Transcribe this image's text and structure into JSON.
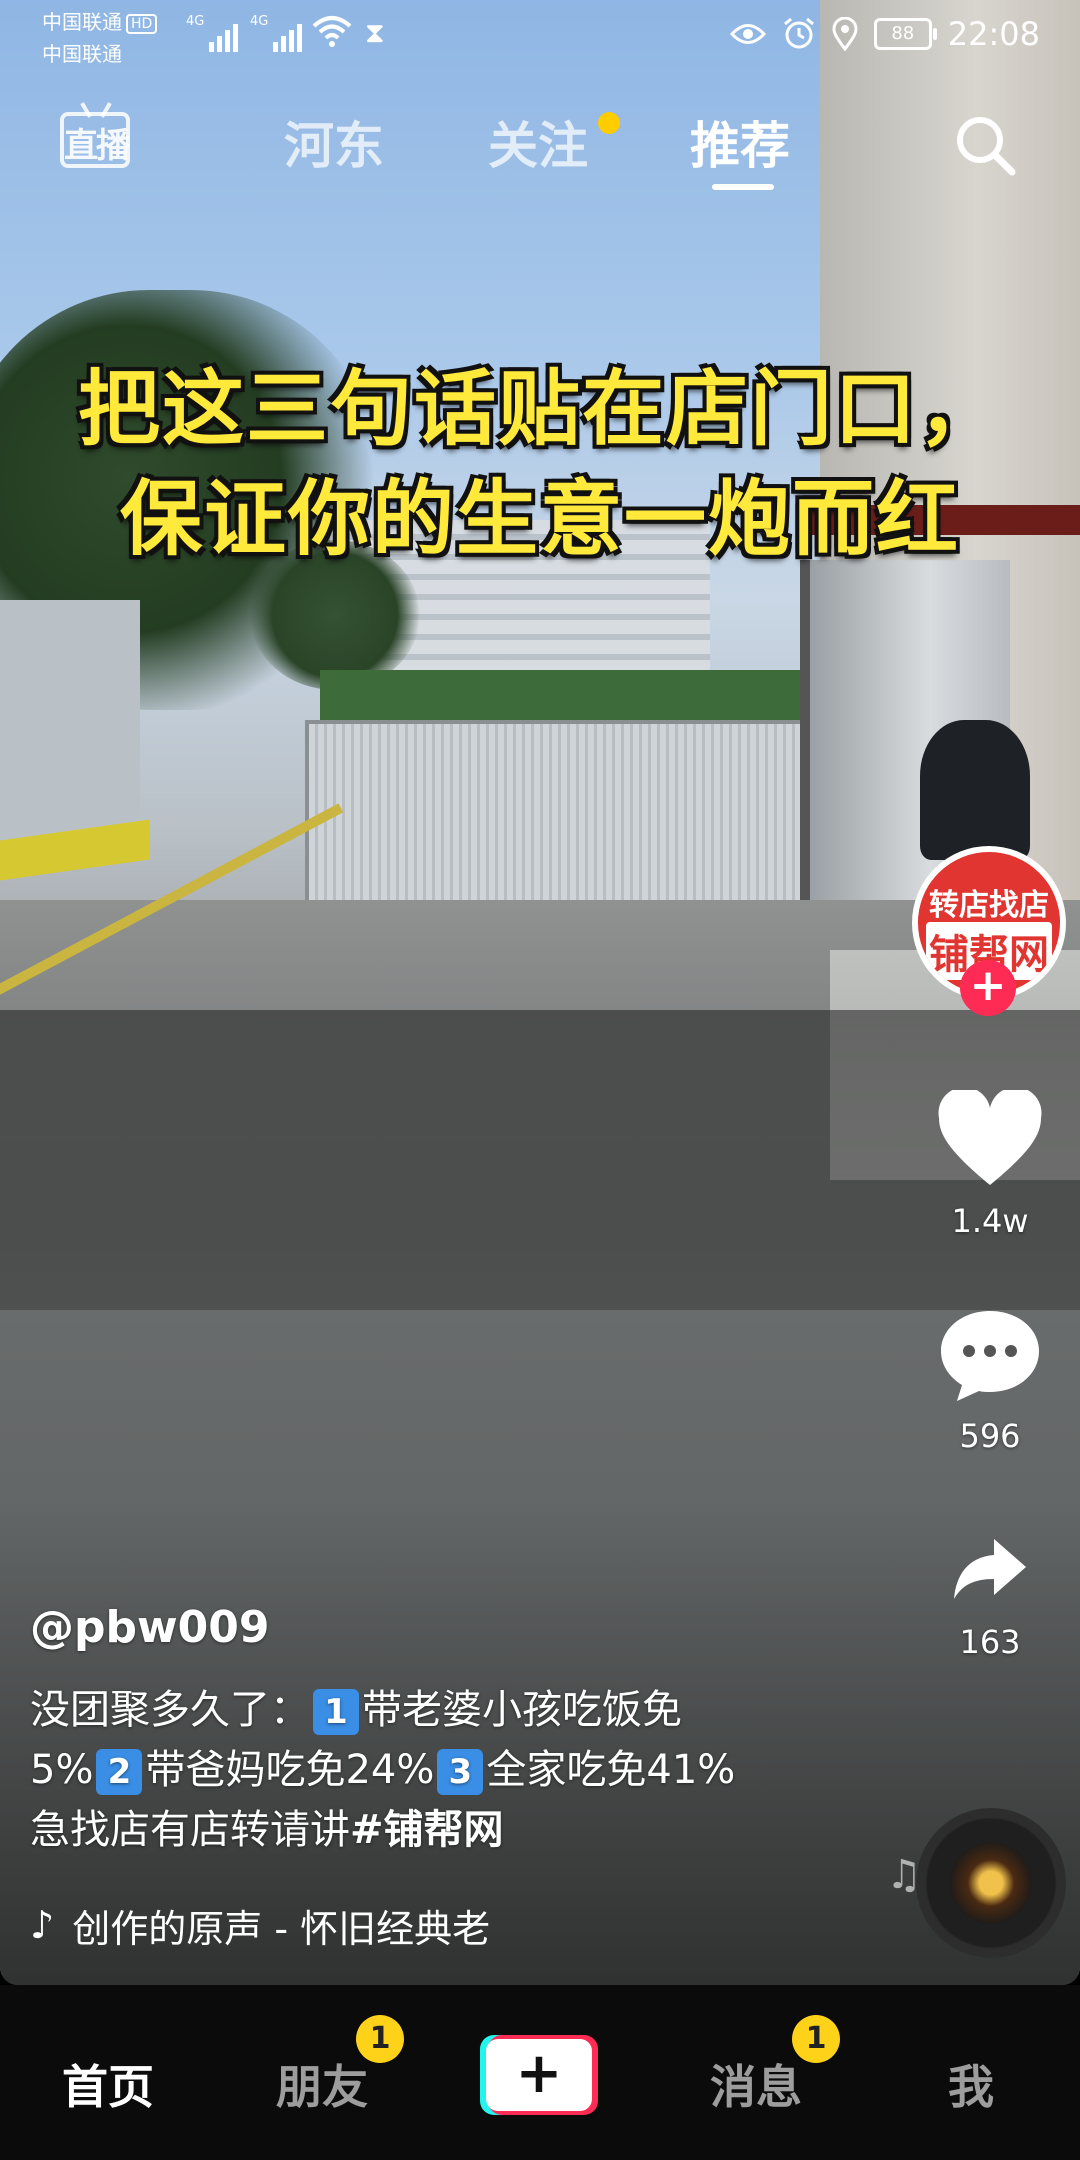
{
  "status_bar": {
    "carrier_1": "中国联通",
    "carrier_2": "中国联通",
    "hd": "HD",
    "net_1": "4G",
    "net_2": "4G",
    "battery": "88",
    "time": "22:08"
  },
  "top_nav": {
    "live_label": "直播",
    "tabs": [
      "河东",
      "关注",
      "推荐"
    ],
    "active_tab": "推荐"
  },
  "video": {
    "caption_line_1": "把这三句话贴在店门口，",
    "caption_line_2": "保证你的生意一炮而红"
  },
  "avatar": {
    "line_1": "转店找店",
    "line_2": "铺帮网"
  },
  "rail": {
    "likes": "1.4w",
    "comments": "596",
    "shares": "163"
  },
  "post": {
    "username": "@pbw009",
    "desc_line_1_a": "没团聚多久了：",
    "desc_line_1_b": "带老婆小孩吃饭免",
    "desc_line_2_a": "5%",
    "desc_line_2_b": "带爸妈吃免24%",
    "desc_line_2_c": "全家吃免41%",
    "desc_line_3_a": "急找店有店转请讲",
    "hashtag": "#铺帮网",
    "num_1": "1",
    "num_2": "2",
    "num_3": "3",
    "music": "创作的原声 - 怀旧经典老"
  },
  "bottom_bar": {
    "home": "首页",
    "friends": "朋友",
    "friends_badge": "1",
    "create": "+",
    "messages": "消息",
    "messages_badge": "1",
    "me": "我"
  },
  "colors": {
    "accent_red": "#fe2c55",
    "accent_cyan": "#25f4ee",
    "badge_yellow": "#ffd21a",
    "caption_yellow": "#ffe93a"
  }
}
